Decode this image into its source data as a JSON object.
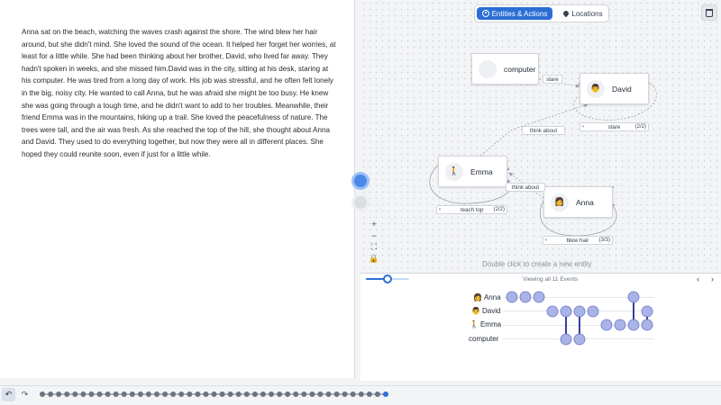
{
  "story": {
    "text": "Anna sat on the beach, watching the waves crash against the shore. The wind blew her hair around, but she didn't mind. She loved the sound of the ocean. It helped her forget her worries, at least for a little while. She had been thinking about her brother, David, who lived far away. They hadn't spoken in weeks, and she missed him.David was in the city, sitting at his desk, staring at his computer. He was tired from a long day of work. His job was stressful, and he often felt lonely in the big, noisy city. He wanted to call Anna, but he was afraid she might be too busy. He knew she was going through a tough time, and he didn't want to add to her troubles. Meanwhile, their friend Emma was in the mountains, hiking up a trail. She loved the peacefulness of nature. The trees were tall, and the air was fresh. As she reached the top of the hill, she thought about Anna and David. They used to do everything together, but now they were all in different places. She hoped they could reunite soon, even if just for a little while."
  },
  "tabs": {
    "entities": "Entities & Actions",
    "locations": "Locations"
  },
  "entities": {
    "computer": {
      "label": "computer",
      "icon": ""
    },
    "david": {
      "label": "David",
      "icon": "👨"
    },
    "emma": {
      "label": "Emma",
      "icon": "🚶"
    },
    "anna": {
      "label": "Anna",
      "icon": "👩"
    }
  },
  "edges": {
    "stare_1": "stare",
    "stare_2": "stare",
    "stare_2_count": "(2/2)",
    "think_about_1": "think about",
    "think_about_2": "think about",
    "reach_top": "reach top",
    "reach_top_count": "(2/2)",
    "blew_hair": "blew hair",
    "blew_hair_count": "(3/3)"
  },
  "zoom": {
    "plus": "+",
    "minus": "−",
    "fit": "⛶",
    "lock": "🔒"
  },
  "hint": "Double click to create a new entity",
  "timeline": {
    "title": "Viewing all 11 Events",
    "rows": [
      "Anna",
      "David",
      "Emma",
      "computer"
    ],
    "row_icons": [
      "👩",
      "👨",
      "🚶",
      ""
    ],
    "prev": "‹",
    "next": "›"
  },
  "history": {
    "undo": "↶",
    "redo": "↷",
    "step_count": 43
  },
  "colors": {
    "accent": "#2b6fd6",
    "event_dot": "#a9b4e6",
    "event_link": "#3a3d9e"
  }
}
